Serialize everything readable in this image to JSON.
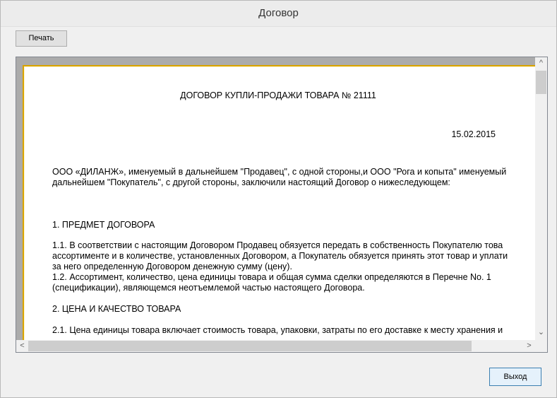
{
  "window": {
    "title": "Договор"
  },
  "toolbar": {
    "print_label": "Печать"
  },
  "footer": {
    "exit_label": "Выход"
  },
  "document": {
    "title": "ДОГОВОР КУПЛИ-ПРОДАЖИ ТОВАРА № 21111",
    "date": "15.02.2015",
    "intro_line1": "ООО «ДИЛАНЖ», именуемый в дальнейшем \"Продавец\", с одной стороны,и ООО \"Рога и копыта\" именуемый",
    "intro_line2": "дальнейшем \"Покупатель\", с другой стороны, заключили настоящий Договор о нижеследующем:",
    "section1_title": "1. ПРЕДМЕТ ДОГОВОРА",
    "p1_1_line1": " 1.1. В соответствии с настоящим Договором Продавец обязуется передать в собственность Покупателю това",
    "p1_1_line2": "ассортименте и в количестве, установленных Договором, а Покупатель обязуется принять этот товар и уплати",
    "p1_1_line3": "за него определенную Договором денежную сумму (цену).",
    "p1_2_line1": " 1.2. Ассортимент, количество, цена единицы товара и общая сумма сделки определяются в Перечне No. 1",
    "p1_2_line2": "(спецификации), являющемся неотъемлемой частью настоящего Договора.",
    "section2_title": " 2. ЦЕНА И КАЧЕСТВО ТОВАРА",
    "p2_1_line1": " 2.1. Цена единицы товара включает стоимость товара, упаковки, затраты по его доставке к месту хранения и"
  },
  "icons": {
    "scroll_up": "scroll-up-arrow",
    "scroll_down": "scroll-down-arrow",
    "scroll_left": "scroll-left-arrow",
    "scroll_right": "scroll-right-arrow"
  }
}
